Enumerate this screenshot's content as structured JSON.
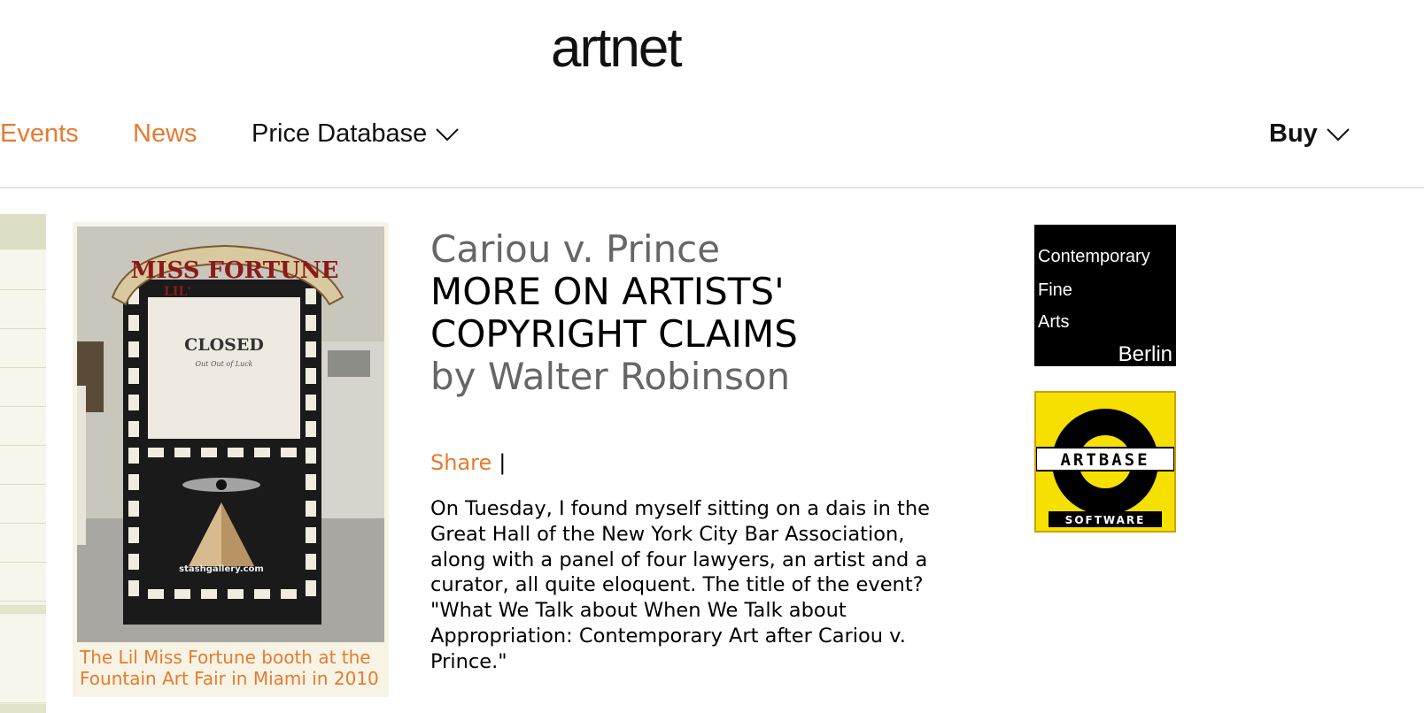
{
  "header": {
    "logo": "artnet"
  },
  "nav": {
    "events": "Events",
    "news": "News",
    "price_database": "Price Database",
    "buy": "Buy"
  },
  "colors": {
    "accent": "#e87a2e",
    "text": "#000000",
    "muted": "#666666"
  },
  "figure": {
    "caption": "The Lil Miss Fortune booth at the Fountain Art Fair in Miami in 2010",
    "photo_text": {
      "banner_prefix": "LIL'",
      "banner": "MISS FORTUNE",
      "sign": "CLOSED",
      "sign_sub": "Out Out of Luck",
      "url": "stashgallery.com"
    }
  },
  "article": {
    "kicker": "Cariou v. Prince",
    "headline_line1": "MORE ON ARTISTS'",
    "headline_line2": "COPYRIGHT CLAIMS",
    "byline": "by Walter Robinson",
    "share": "Share",
    "separator": "|",
    "body": "On Tuesday, I found myself sitting on a dais in the Great Hall of the New York City Bar Association, along with a panel of four lawyers, an artist and a curator, all quite eloquent. The title of the event? \"What We Talk about When We Talk about Appropriation: Contemporary Art after Cariou v. Prince.\""
  },
  "ads": {
    "cfa": {
      "line1": "Contemporary",
      "line2": "Fine",
      "line3": "Arts",
      "city": "Berlin"
    },
    "artbase": {
      "name": "ARTBASE",
      "sub": "SOFTWARE"
    }
  }
}
